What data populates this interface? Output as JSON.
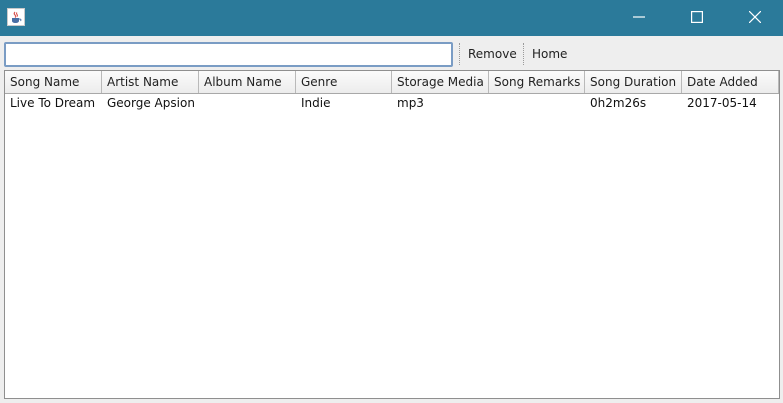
{
  "window": {
    "title": "",
    "icon": "java-cup-icon",
    "controls": [
      "minimize-icon",
      "maximize-icon",
      "close-icon"
    ],
    "titlebar_color": "#2b7a9a"
  },
  "toolbar": {
    "search_value": "",
    "remove_label": "Remove",
    "home_label": "Home"
  },
  "table": {
    "columns": [
      "Song Name",
      "Artist Name",
      "Album Name",
      "Genre",
      "Storage Media",
      "Song Remarks",
      "Song Duration",
      "Date Added"
    ],
    "rows": [
      [
        "Live To Dream",
        "George Apsion",
        "",
        "Indie",
        "mp3",
        "",
        "0h2m26s",
        "2017-05-14"
      ]
    ]
  }
}
